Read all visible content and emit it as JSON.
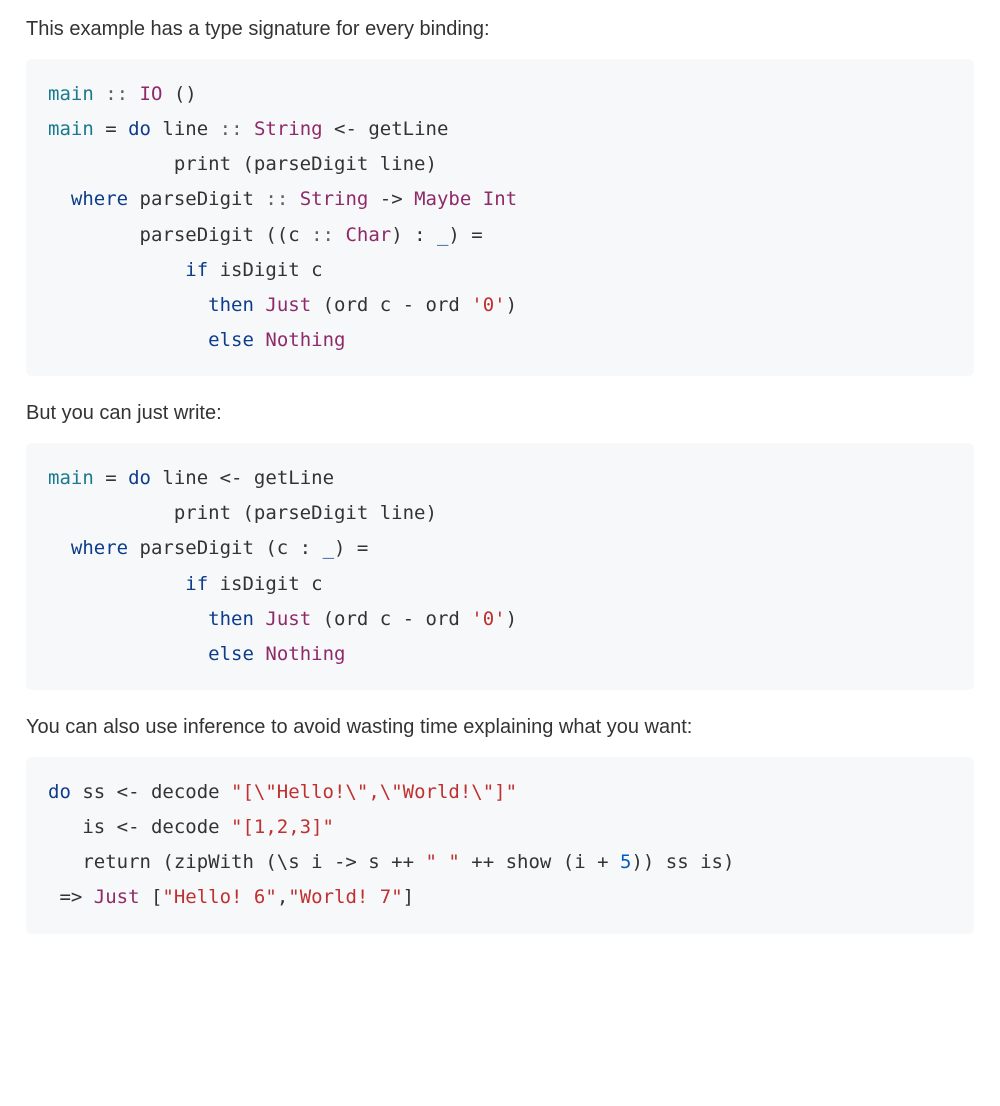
{
  "paragraphs": {
    "p1": "This example has a type signature for every binding:",
    "p2": "But you can just write:",
    "p3": "You can also use inference to avoid wasting time explaining what you want:"
  },
  "code1": {
    "l1_main": "main",
    "l1_b": " :: ",
    "l1_IO": "IO",
    "l1_c": " ()",
    "l2_main": "main",
    "l2_a": " = ",
    "l2_do": "do",
    "l2_b": " line ",
    "l2_c": ":: ",
    "l2_String": "String",
    "l2_d": " <- getLine",
    "l3": "           print (parseDigit line)",
    "l4_a": "  ",
    "l4_where": "where",
    "l4_b": " parseDigit ",
    "l4_c": ":: ",
    "l4_String": "String",
    "l4_d": " -> ",
    "l4_Maybe": "Maybe",
    "l4_e": " ",
    "l4_Int": "Int",
    "l5_a": "        parseDigit ((c ",
    "l5_b": ":: ",
    "l5_Char": "Char",
    "l5_c": ") : ",
    "l5_d": "_",
    "l5_e": ") =",
    "l6_a": "            ",
    "l6_if": "if",
    "l6_b": " isDigit c",
    "l7_a": "              ",
    "l7_then": "then",
    "l7_b": " ",
    "l7_Just": "Just",
    "l7_c": " (ord c - ord ",
    "l7_ch": "'0'",
    "l7_d": ")",
    "l8_a": "              ",
    "l8_else": "else",
    "l8_b": " ",
    "l8_Nothing": "Nothing"
  },
  "code2": {
    "l1_main": "main",
    "l1_a": " = ",
    "l1_do": "do",
    "l1_b": " line <- getLine",
    "l2": "           print (parseDigit line)",
    "l3_a": "  ",
    "l3_where": "where",
    "l3_b": " parseDigit (c : ",
    "l3_c": "_",
    "l3_d": ") =",
    "l4_a": "            ",
    "l4_if": "if",
    "l4_b": " isDigit c",
    "l5_a": "              ",
    "l5_then": "then",
    "l5_b": " ",
    "l5_Just": "Just",
    "l5_c": " (ord c - ord ",
    "l5_ch": "'0'",
    "l5_d": ")",
    "l6_a": "              ",
    "l6_else": "else",
    "l6_b": " ",
    "l6_Nothing": "Nothing"
  },
  "code3": {
    "l1_do": "do",
    "l1_a": " ss <- decode ",
    "l1_s": "\"[\\\"Hello!\\\",\\\"World!\\\"]\"",
    "l2_a": "   is <- decode ",
    "l2_s": "\"[1,2,3]\"",
    "l3_a": "   return (zipWith (\\s i -> s ++ ",
    "l3_s": "\" \"",
    "l3_b": " ++ show (i + ",
    "l3_n": "5",
    "l3_c": ")) ss is)",
    "l4_a": " => ",
    "l4_Just": "Just",
    "l4_b": " [",
    "l4_s1": "\"Hello! 6\"",
    "l4_c": ",",
    "l4_s2": "\"World! 7\"",
    "l4_d": "]"
  }
}
